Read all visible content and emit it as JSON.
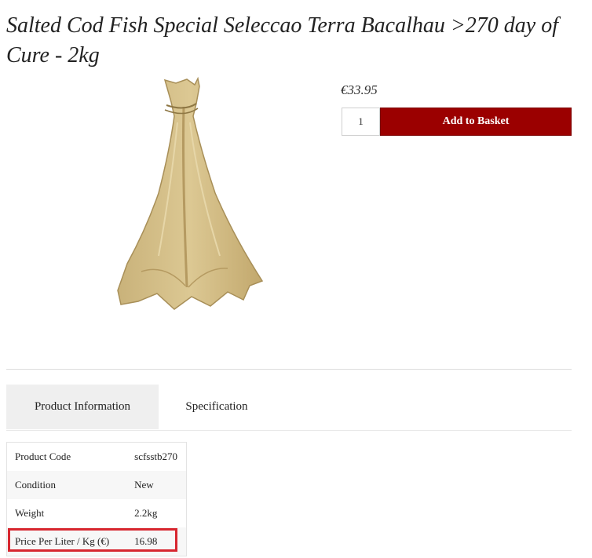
{
  "product": {
    "title": "Salted Cod Fish Special Seleccao Terra Bacalhau >270 day of Cure - 2kg",
    "price": "€33.95",
    "quantity": "1",
    "add_to_basket_label": "Add to Basket"
  },
  "tabs": [
    {
      "label": "Product Information",
      "active": true
    },
    {
      "label": "Specification",
      "active": false
    }
  ],
  "info_table": [
    {
      "label": "Product Code",
      "value": "scfsstb270"
    },
    {
      "label": "Condition",
      "value": "New"
    },
    {
      "label": "Weight",
      "value": "2.2kg"
    },
    {
      "label": "Price Per Liter / Kg (€)",
      "value": "16.98"
    }
  ],
  "colors": {
    "accent": "#9b0000",
    "highlight": "#d7262f",
    "tab_active_bg": "#efefef"
  }
}
